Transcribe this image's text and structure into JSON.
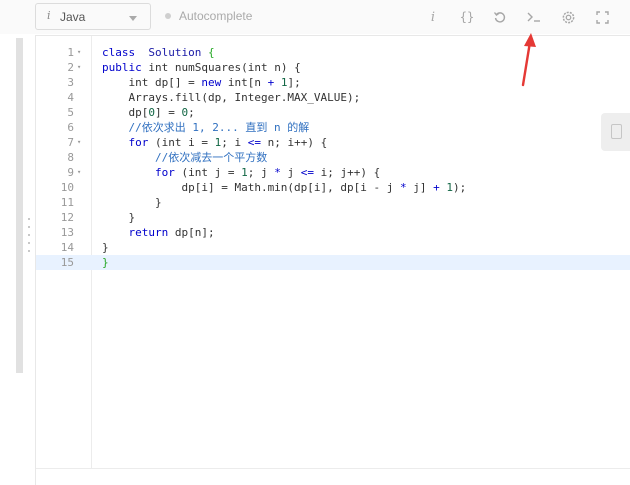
{
  "toolbar": {
    "language_info_glyph": "i",
    "language": "Java",
    "autocomplete_label": "Autocomplete",
    "icons": [
      "info-icon",
      "braces-icon",
      "reset-icon",
      "console-icon",
      "settings-icon",
      "fullscreen-icon"
    ]
  },
  "editor": {
    "lines": [
      {
        "n": "1",
        "fold": true,
        "active": false
      },
      {
        "n": "2",
        "fold": true,
        "active": false
      },
      {
        "n": "3",
        "fold": false,
        "active": false
      },
      {
        "n": "4",
        "fold": false,
        "active": false
      },
      {
        "n": "5",
        "fold": false,
        "active": false
      },
      {
        "n": "6",
        "fold": false,
        "active": false
      },
      {
        "n": "7",
        "fold": true,
        "active": false
      },
      {
        "n": "8",
        "fold": false,
        "active": false
      },
      {
        "n": "9",
        "fold": true,
        "active": false
      },
      {
        "n": "10",
        "fold": false,
        "active": false
      },
      {
        "n": "11",
        "fold": false,
        "active": false
      },
      {
        "n": "12",
        "fold": false,
        "active": false
      },
      {
        "n": "13",
        "fold": false,
        "active": false
      },
      {
        "n": "14",
        "fold": false,
        "active": false
      },
      {
        "n": "15",
        "fold": false,
        "active": true
      }
    ],
    "code": [
      [
        [
          "kw",
          "class"
        ],
        [
          "",
          "  "
        ],
        [
          "cls",
          "Solution"
        ],
        [
          "",
          " "
        ],
        [
          "cur",
          "{"
        ]
      ],
      [
        [
          "kw",
          "public"
        ],
        [
          "",
          " int numSquares(int n) {"
        ]
      ],
      [
        [
          "",
          "    int dp[] = "
        ],
        [
          "kw",
          "new"
        ],
        [
          "",
          " int[n "
        ],
        [
          "kw",
          "+"
        ],
        [
          "",
          " "
        ],
        [
          "num",
          "1"
        ],
        [
          "",
          "];"
        ]
      ],
      [
        [
          "",
          "    Arrays.fill(dp, Integer.MAX_VALUE);"
        ]
      ],
      [
        [
          "",
          "    dp["
        ],
        [
          "num",
          "0"
        ],
        [
          "",
          "] = "
        ],
        [
          "num",
          "0"
        ],
        [
          "",
          ";"
        ]
      ],
      [
        [
          "cm",
          "    //依次求出 1, 2... 直到 n 的解"
        ]
      ],
      [
        [
          "",
          "    "
        ],
        [
          "kw",
          "for"
        ],
        [
          "",
          " (int i = "
        ],
        [
          "num",
          "1"
        ],
        [
          "",
          "; i "
        ],
        [
          "kw",
          "<="
        ],
        [
          "",
          " n; i++) {"
        ]
      ],
      [
        [
          "cm",
          "        //依次减去一个平方数"
        ]
      ],
      [
        [
          "",
          "        "
        ],
        [
          "kw",
          "for"
        ],
        [
          "",
          " (int j = "
        ],
        [
          "num",
          "1"
        ],
        [
          "",
          "; j "
        ],
        [
          "kw",
          "*"
        ],
        [
          "",
          " j "
        ],
        [
          "kw",
          "<="
        ],
        [
          "",
          " i; j++) {"
        ]
      ],
      [
        [
          "",
          "            dp[i] = Math.min(dp[i], dp[i - j "
        ],
        [
          "kw",
          "*"
        ],
        [
          "",
          " j] "
        ],
        [
          "kw",
          "+"
        ],
        [
          "",
          " "
        ],
        [
          "num",
          "1"
        ],
        [
          "",
          ");"
        ]
      ],
      [
        [
          "",
          "        }"
        ]
      ],
      [
        [
          "",
          "    }"
        ]
      ],
      [
        [
          "",
          "    "
        ],
        [
          "kw",
          "return"
        ],
        [
          "",
          " dp[n];"
        ]
      ],
      [
        [
          "",
          "}"
        ]
      ],
      [
        [
          "cur",
          "}"
        ]
      ]
    ]
  },
  "colors": {
    "keyword": "#0000cc",
    "comment": "#3070c0",
    "active_line": "#e8f2ff",
    "annotation_arrow": "#e53935"
  }
}
